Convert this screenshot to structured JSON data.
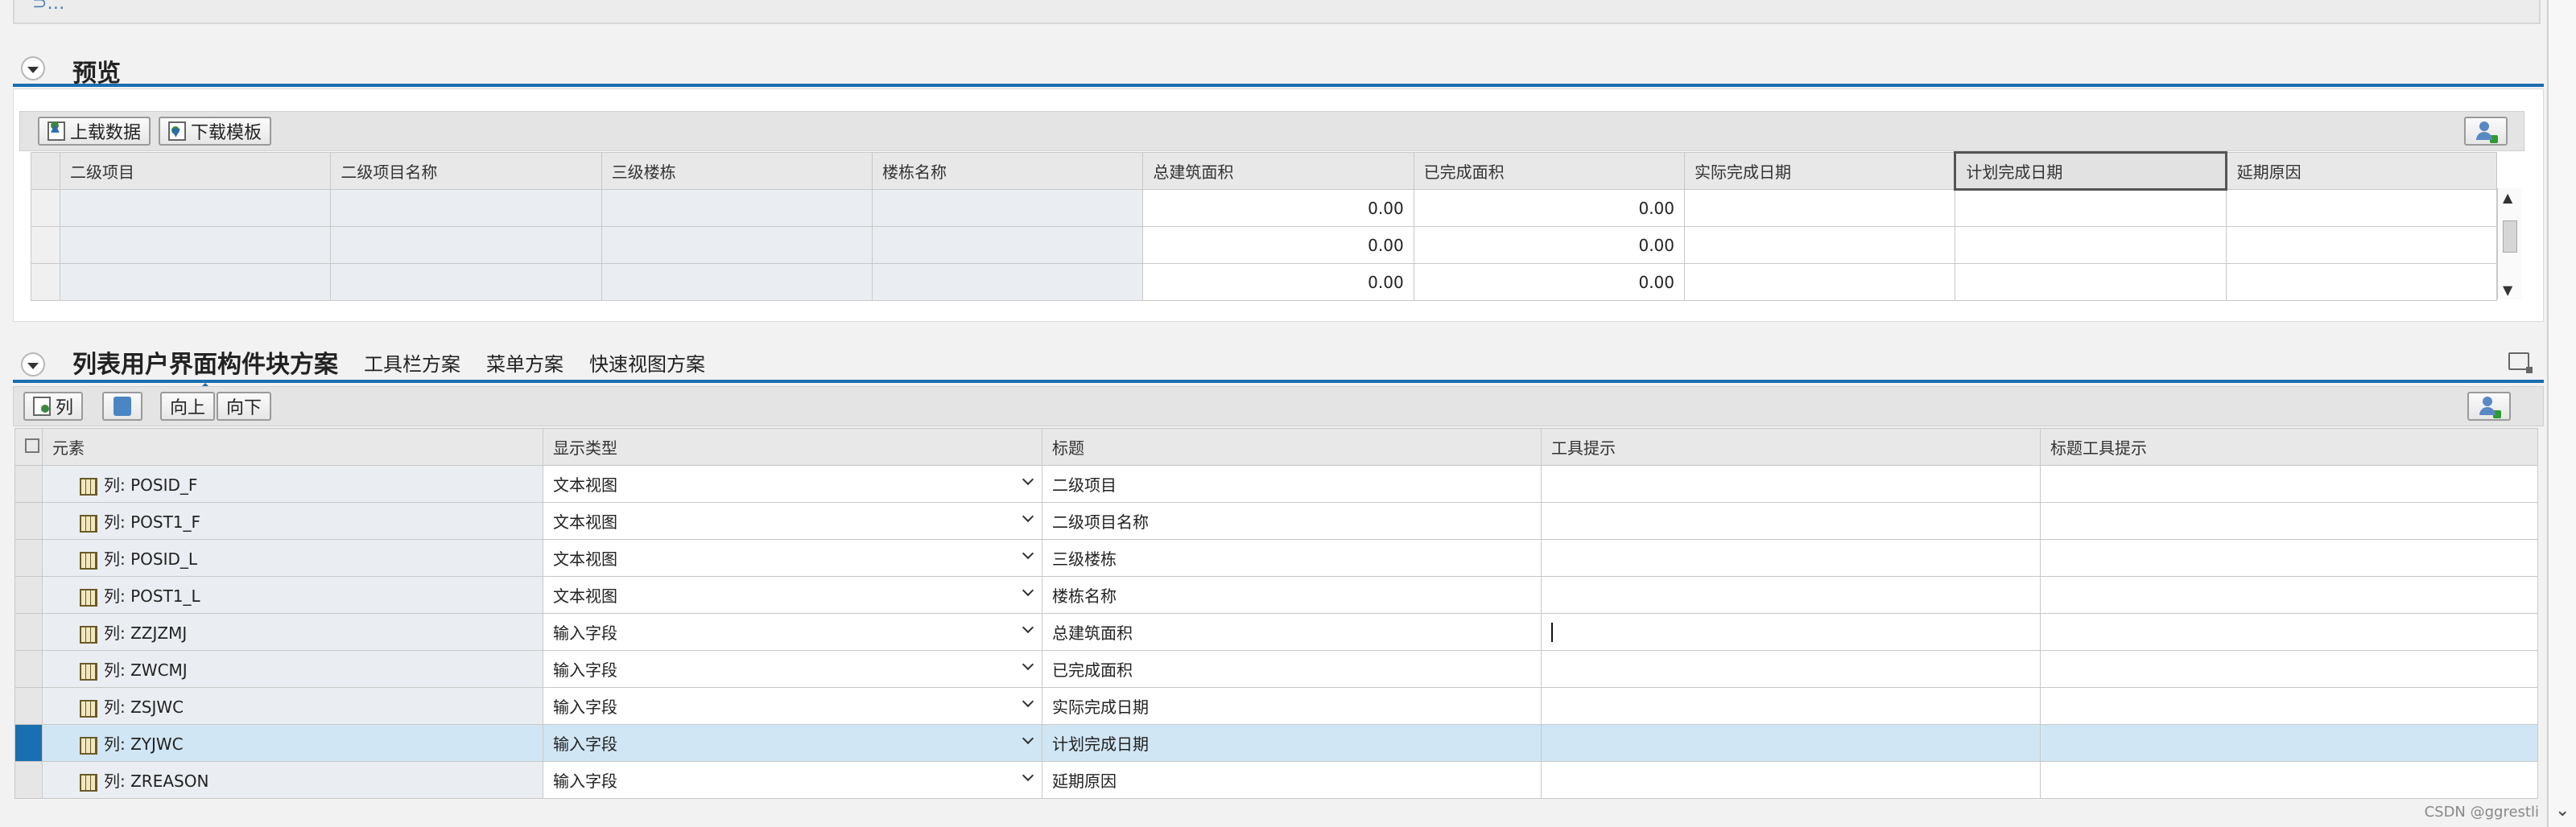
{
  "preview": {
    "title": "预览",
    "toolbar": {
      "upload_label": "上载数据",
      "download_label": "下载模板"
    },
    "columns": [
      "二级项目",
      "二级项目名称",
      "三级楼栋",
      "楼栋名称",
      "总建筑面积",
      "已完成面积",
      "实际完成日期",
      "计划完成日期",
      "延期原因"
    ],
    "rows": [
      [
        "",
        "",
        "",
        "",
        "0.00",
        "0.00",
        "",
        "",
        ""
      ],
      [
        "",
        "",
        "",
        "",
        "0.00",
        "0.00",
        "",
        "",
        ""
      ],
      [
        "",
        "",
        "",
        "",
        "0.00",
        "0.00",
        "",
        "",
        ""
      ]
    ]
  },
  "list_ui": {
    "tabs": [
      "列表用户界面构件块方案",
      "工具栏方案",
      "菜单方案",
      "快速视图方案"
    ],
    "toolbar": {
      "add_column_label": "列",
      "move_up_label": "向上",
      "move_down_label": "向下"
    },
    "columns": [
      "元素",
      "显示类型",
      "标题",
      "工具提示",
      "标题工具提示"
    ],
    "rows": [
      {
        "element": "列: POSID_F",
        "display_type": "文本视图",
        "title": "二级项目",
        "tooltip": "",
        "title_tooltip": ""
      },
      {
        "element": "列: POST1_F",
        "display_type": "文本视图",
        "title": "二级项目名称",
        "tooltip": "",
        "title_tooltip": ""
      },
      {
        "element": "列: POSID_L",
        "display_type": "文本视图",
        "title": "三级楼栋",
        "tooltip": "",
        "title_tooltip": ""
      },
      {
        "element": "列: POST1_L",
        "display_type": "文本视图",
        "title": "楼栋名称",
        "tooltip": "",
        "title_tooltip": ""
      },
      {
        "element": "列: ZZJZMJ",
        "display_type": "输入字段",
        "title": "总建筑面积",
        "tooltip": "",
        "title_tooltip": ""
      },
      {
        "element": "列: ZWCMJ",
        "display_type": "输入字段",
        "title": "已完成面积",
        "tooltip": "",
        "title_tooltip": ""
      },
      {
        "element": "列: ZSJWC",
        "display_type": "输入字段",
        "title": "实际完成日期",
        "tooltip": "",
        "title_tooltip": ""
      },
      {
        "element": "列: ZYJWC",
        "display_type": "输入字段",
        "title": "计划完成日期",
        "tooltip": "",
        "title_tooltip": ""
      },
      {
        "element": "列: ZREASON",
        "display_type": "输入字段",
        "title": "延期原因",
        "tooltip": "",
        "title_tooltip": ""
      }
    ]
  },
  "watermark": "CSDN @ggrestli",
  "colors": {
    "accent": "#1a6fb0",
    "highlight_row": "#d1e6f4"
  }
}
